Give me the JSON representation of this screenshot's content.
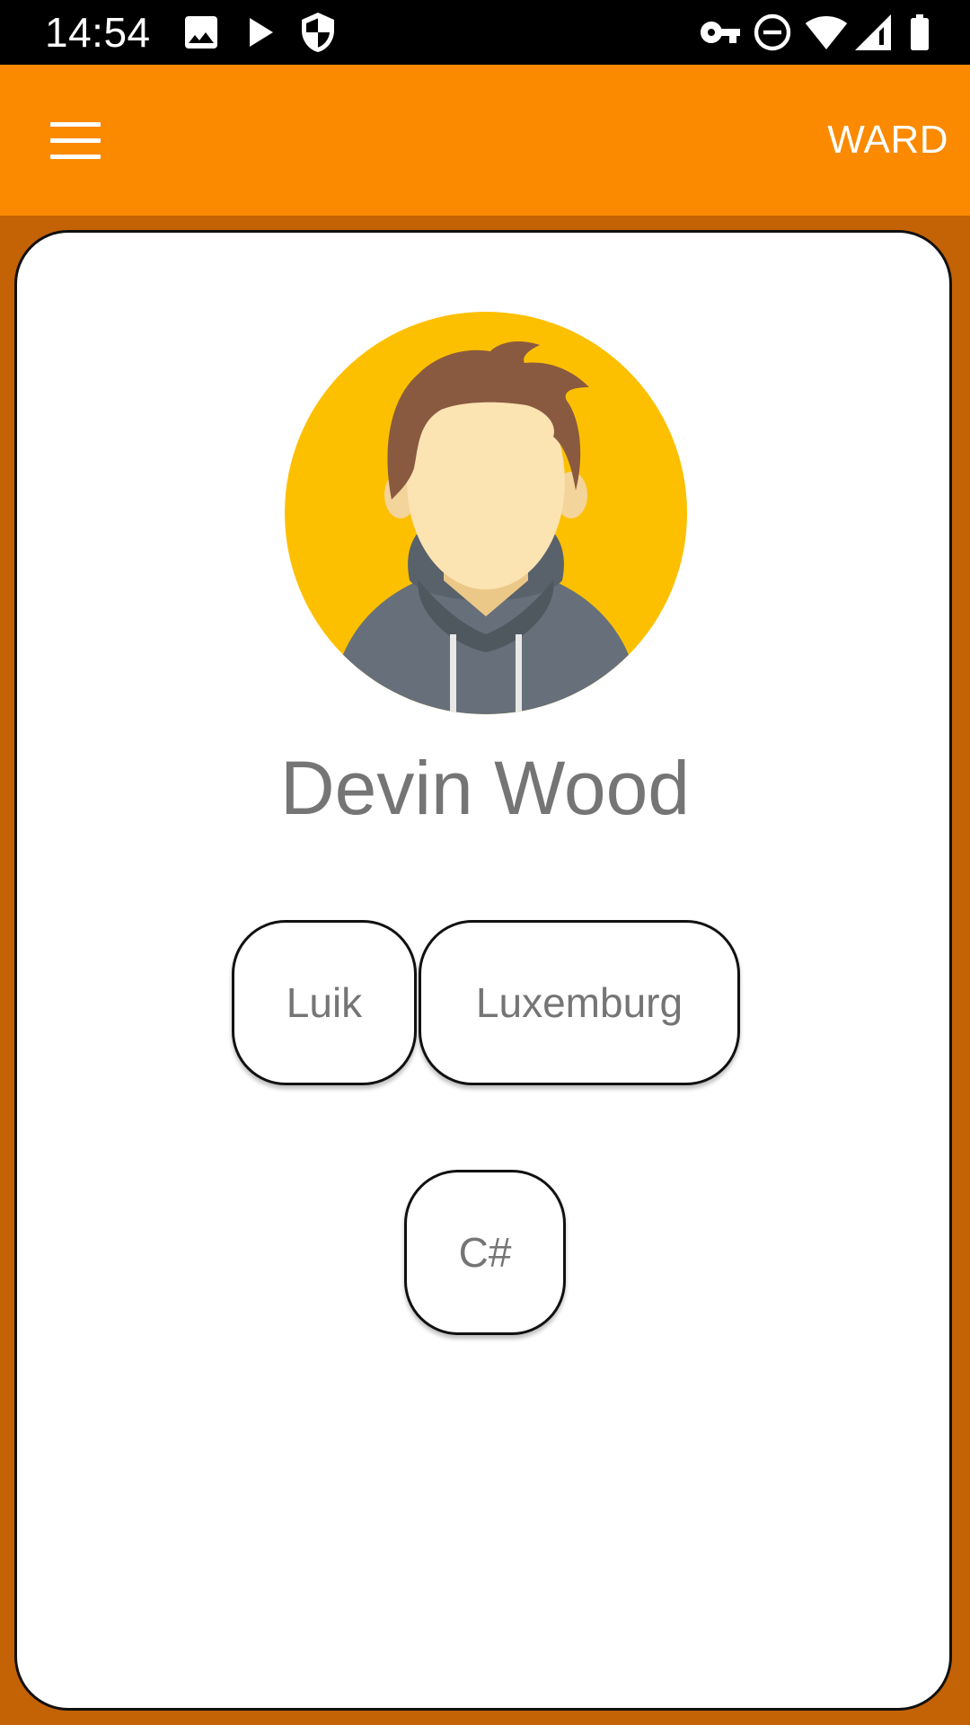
{
  "status_bar": {
    "time": "14:54",
    "left_icons": [
      "image-icon",
      "play-icon",
      "shield-icon"
    ],
    "right_icons": [
      "key-icon",
      "do-not-disturb-icon",
      "wifi-icon",
      "cellular-signal-icon",
      "battery-icon"
    ]
  },
  "app_bar": {
    "menu_icon": "hamburger-menu-icon",
    "title": "WARD"
  },
  "profile": {
    "name": "Devin Wood",
    "avatar_icon": "person-avatar-icon",
    "locations": [
      "Luik",
      "Luxemburg"
    ],
    "skills": [
      "C#"
    ]
  },
  "colors": {
    "app_bar": "#fb8a00",
    "background": "#c46206",
    "card": "#ffffff",
    "avatar_bg": "#fdc000",
    "text_gray": "#757575"
  }
}
